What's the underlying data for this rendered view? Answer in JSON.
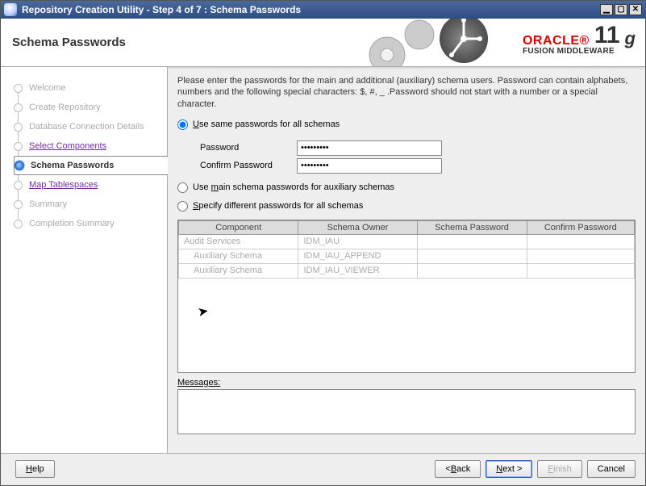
{
  "window": {
    "title": "Repository Creation Utility - Step 4 of 7 : Schema Passwords"
  },
  "header": {
    "page_title": "Schema Passwords",
    "brand_oracle": "ORACLE",
    "brand_fm": "FUSION MIDDLEWARE",
    "brand_version": "11",
    "brand_g": "g"
  },
  "steps": [
    {
      "label": "Welcome"
    },
    {
      "label": "Create Repository"
    },
    {
      "label": "Database Connection Details"
    },
    {
      "label": "Select Components"
    },
    {
      "label": "Schema Passwords"
    },
    {
      "label": "Map Tablespaces"
    },
    {
      "label": "Summary"
    },
    {
      "label": "Completion Summary"
    }
  ],
  "main": {
    "instruction": "Please enter the passwords for the main and additional (auxiliary) schema users. Password can contain alphabets, numbers and the following special characters: $, #, _ .Password should not start with a number or a special character.",
    "radio_same": "se same passwords for all schemas",
    "radio_same_ul": "U",
    "password_label": "Password",
    "password_value": "●●●●●●●●●",
    "confirm_label": "Confirm Password",
    "confirm_value": "●●●●●●●●●",
    "radio_main_pre": "Use ",
    "radio_main_ul": "m",
    "radio_main_post": "ain schema passwords for auxiliary schemas",
    "radio_diff_ul": "S",
    "radio_diff": "pecify different passwords for all schemas",
    "table": {
      "headers": [
        "Component",
        "Schema Owner",
        "Schema Password",
        "Confirm Password"
      ],
      "rows": [
        {
          "component": "Audit Services",
          "owner": "IDM_IAU",
          "pw": "",
          "cpw": "",
          "indent": false
        },
        {
          "component": "Auxiliary Schema",
          "owner": "IDM_IAU_APPEND",
          "pw": "",
          "cpw": "",
          "indent": true
        },
        {
          "component": "Auxiliary Schema",
          "owner": "IDM_IAU_VIEWER",
          "pw": "",
          "cpw": "",
          "indent": true
        }
      ]
    },
    "messages_label_ul": "M",
    "messages_label": "essages:"
  },
  "footer": {
    "help_ul": "H",
    "help": "elp",
    "back_pre": "< ",
    "back_ul": "B",
    "back_post": "ack",
    "next_ul": "N",
    "next_post": "ext >",
    "finish_ul": "F",
    "finish_post": "inish",
    "cancel": "Cancel"
  }
}
